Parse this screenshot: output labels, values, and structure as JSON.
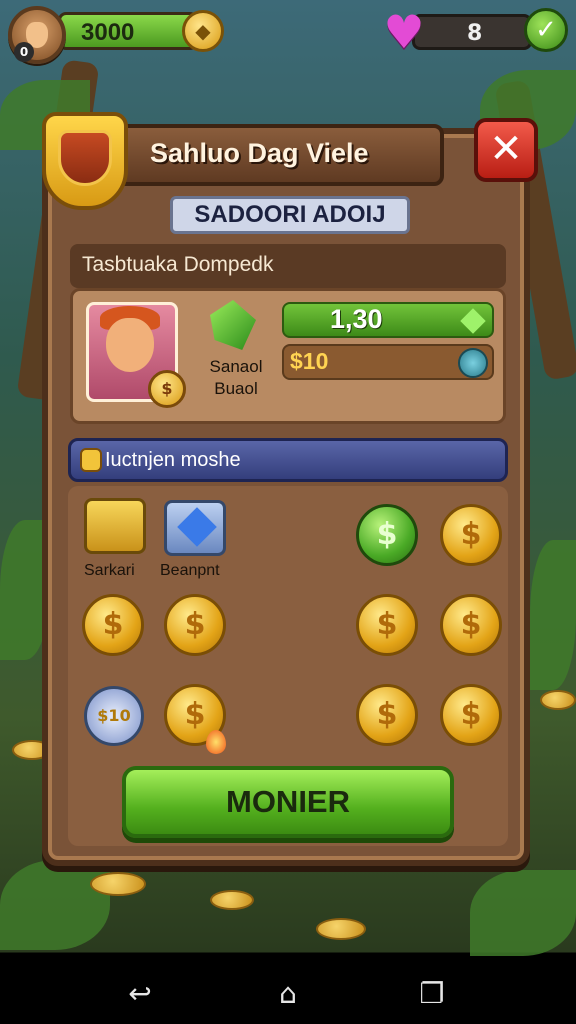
{
  "hud": {
    "level": "0",
    "coins": "3000",
    "coin_badge_icon": "gold-diamond-icon",
    "heart_icon": "heart-icon",
    "hearts": "8",
    "confirm_icon": "green-check-icon"
  },
  "dialog": {
    "title": "Sahluo Dag Viele",
    "subtitle": "SADOORI ADOIJ",
    "close_icon": "close-icon",
    "section_header": "Tasbtuaka Dompedk",
    "card": {
      "label": "Sanaol Buaol",
      "value_primary": "1,30",
      "value_secondary": "$10",
      "portrait_badge": "$"
    },
    "banner": "Iuctnjen moshe",
    "items": {
      "first_label": "Sarkari",
      "second_label": "Beanpnt",
      "ticket_label": "$10"
    },
    "coin_symbol": "$",
    "cta_label": "MONIER"
  },
  "navbar": {
    "back_icon": "back-icon",
    "home_icon": "home-icon",
    "recents_icon": "recents-icon"
  },
  "colors": {
    "panel": "#7a5338",
    "accent_green": "#54b01e",
    "close_red": "#d8392a",
    "gold": "#e3a417",
    "banner_blue": "#414b8e"
  }
}
